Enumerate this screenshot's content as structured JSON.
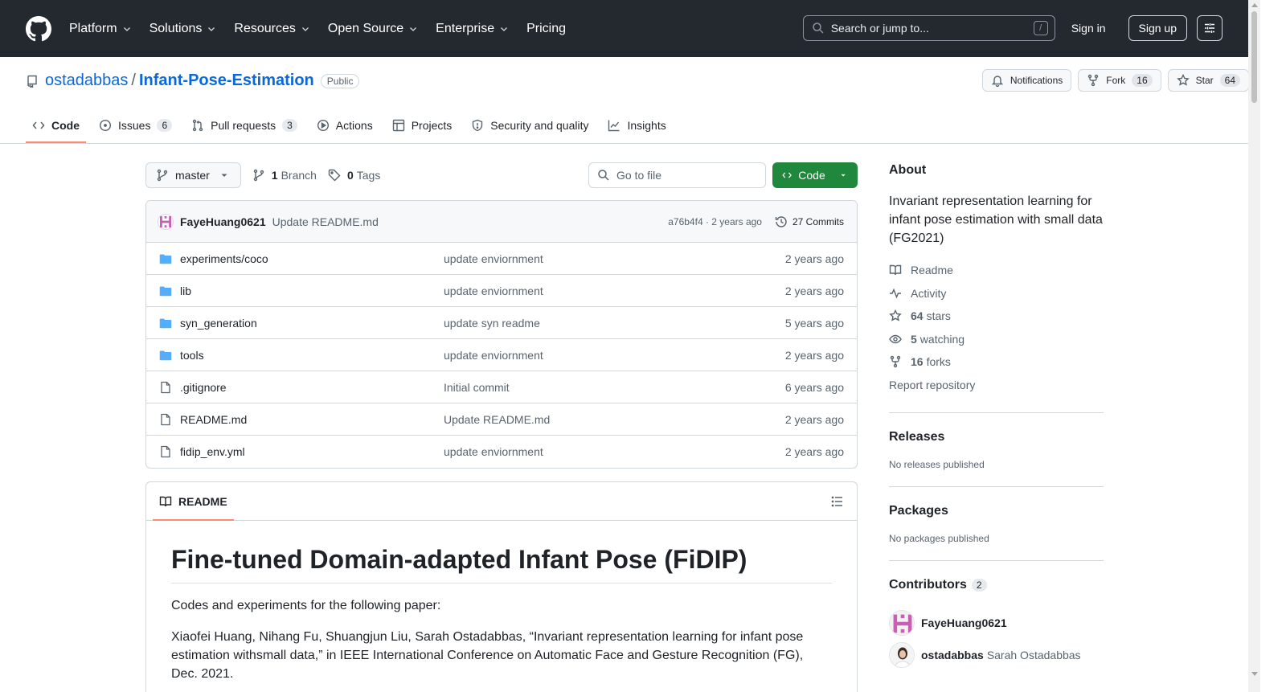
{
  "header": {
    "nav": [
      "Platform",
      "Solutions",
      "Resources",
      "Open Source",
      "Enterprise",
      "Pricing"
    ],
    "search_placeholder": "Search or jump to...",
    "search_shortcut": "/",
    "sign_in": "Sign in",
    "sign_up": "Sign up"
  },
  "repo": {
    "owner": "ostadabbas",
    "separator": "/",
    "name": "Infant-Pose-Estimation",
    "visibility": "Public",
    "notifications_label": "Notifications",
    "fork_label": "Fork",
    "fork_count": "16",
    "star_label": "Star",
    "star_count": "64"
  },
  "tabs": [
    {
      "label": "Code",
      "icon": "code-icon",
      "count": ""
    },
    {
      "label": "Issues",
      "icon": "issue-icon",
      "count": "6"
    },
    {
      "label": "Pull requests",
      "icon": "pull-request-icon",
      "count": "3"
    },
    {
      "label": "Actions",
      "icon": "play-icon",
      "count": ""
    },
    {
      "label": "Projects",
      "icon": "table-icon",
      "count": ""
    },
    {
      "label": "Security and quality",
      "icon": "shield-icon",
      "count": ""
    },
    {
      "label": "Insights",
      "icon": "graph-icon",
      "count": ""
    }
  ],
  "toolbar": {
    "branch": "master",
    "branch_count": "1",
    "branch_label": "Branch",
    "tag_count": "0",
    "tag_label": "Tags",
    "goto_placeholder": "Go to file",
    "code_label": "Code"
  },
  "latest_commit": {
    "author": "FayeHuang0621",
    "message": "Update README.md",
    "hash_time": "a76b4f4 · 2 years ago",
    "commits": "27 Commits"
  },
  "files": [
    {
      "name": "experiments/coco",
      "type": "folder",
      "message": "update enviornment",
      "time": "2 years ago"
    },
    {
      "name": "lib",
      "type": "folder",
      "message": "update enviornment",
      "time": "2 years ago"
    },
    {
      "name": "syn_generation",
      "type": "folder",
      "message": "update syn readme",
      "time": "5 years ago"
    },
    {
      "name": "tools",
      "type": "folder",
      "message": "update enviornment",
      "time": "2 years ago"
    },
    {
      "name": ".gitignore",
      "type": "file",
      "message": "Initial commit",
      "time": "6 years ago"
    },
    {
      "name": "README.md",
      "type": "file",
      "message": "Update README.md",
      "time": "2 years ago"
    },
    {
      "name": "fidip_env.yml",
      "type": "file",
      "message": "update enviornment",
      "time": "2 years ago"
    }
  ],
  "readme": {
    "tab_label": "README",
    "title": "Fine-tuned Domain-adapted Infant Pose (FiDIP)",
    "p1": "Codes and experiments for the following paper:",
    "p2": "Xiaofei Huang, Nihang Fu, Shuangjun Liu, Sarah Ostadabbas, “Invariant representation learning for infant pose estimation withsmall data,” in IEEE International Conference on Automatic Face and Gesture Recognition (FG), Dec. 2021."
  },
  "sidebar": {
    "about_title": "About",
    "description": "Invariant representation learning for infant pose estimation with small data (FG2021)",
    "readme": "Readme",
    "activity": "Activity",
    "stars_count": "64",
    "stars_label": "stars",
    "watching_count": "5",
    "watching_label": "watching",
    "forks_count": "16",
    "forks_label": "forks",
    "report": "Report repository",
    "releases_title": "Releases",
    "releases_note": "No releases published",
    "packages_title": "Packages",
    "packages_note": "No packages published",
    "contributors_title": "Contributors",
    "contributors_count": "2",
    "contributors": [
      {
        "login": "FayeHuang0621",
        "name": ""
      },
      {
        "login": "ostadabbas",
        "name": "Sarah Ostadabbas"
      }
    ]
  },
  "colors": {
    "header_bg": "#24292f",
    "link": "#0969da",
    "primary_button": "#1f883d",
    "tab_underline": "#fd8c73",
    "folder_icon": "#54aeff"
  }
}
